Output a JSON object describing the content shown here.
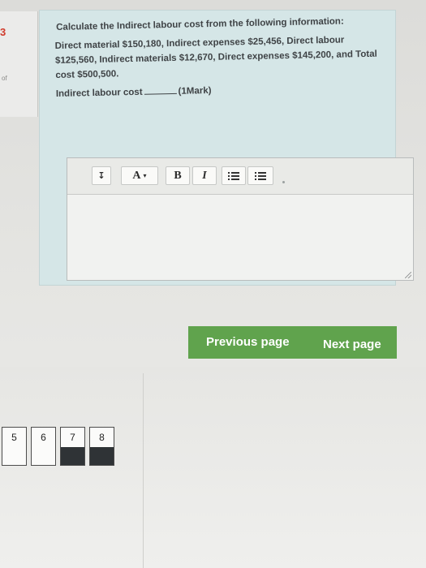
{
  "question_info": {
    "number": "3",
    "marks_label": "of"
  },
  "question": {
    "intro": "Calculate the Indirect labour cost from the following information:",
    "data": "Direct material $150,180, Indirect expenses $25,456, Direct labour $125,560, Indirect materials $12,670, Direct expenses $145,200, and Total cost $500,500.",
    "prompt_label": "Indirect labour cost",
    "marks": "(1Mark)"
  },
  "editor": {
    "toolbar": {
      "expand_icon": "↧",
      "font_label": "A",
      "font_caret": "▾",
      "bold_label": "B",
      "italic_label": "I",
      "bullet_list_icon": "bullet-list-icon",
      "numbered_list_icon": "numbered-list-icon"
    },
    "answer_value": ""
  },
  "navigation": {
    "previous_label": "Previous page",
    "next_label": "Next page",
    "accent_color": "#60a34d"
  },
  "quiz_nav": {
    "buttons": [
      {
        "label": "5",
        "answered": false
      },
      {
        "label": "6",
        "answered": false
      },
      {
        "label": "7",
        "answered": true
      },
      {
        "label": "8",
        "answered": true
      }
    ]
  },
  "colors": {
    "question_number": "#d03a2b",
    "card_background": "#d5e6e7"
  }
}
